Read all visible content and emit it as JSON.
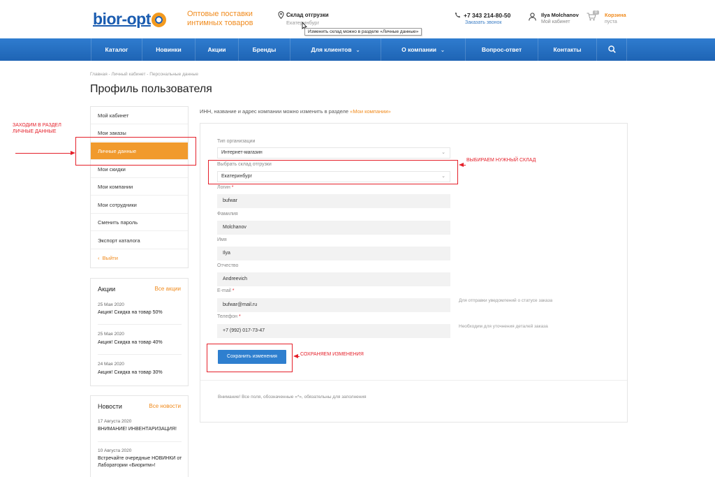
{
  "header": {
    "logo_text": "bior-opt",
    "tagline_line1": "Оптовые поставки",
    "tagline_line2": "интимных товаров",
    "warehouse_title": "Склад отгрузки",
    "warehouse_city": "Екатеринбург",
    "tooltip": "Изменить склад можно в разделе «Личные данные»",
    "phone": "+7 343 214-80-50",
    "callback": "Заказать звонок",
    "user_name": "Ilya Molchanov",
    "user_sub": "Мой кабинет",
    "cart_title": "Корзина",
    "cart_sub": "пуста",
    "cart_count": "0",
    "icons": [
      "map-pin-icon",
      "phone-icon",
      "user-icon",
      "cart-icon",
      "search-icon"
    ]
  },
  "nav": {
    "items": [
      "Каталог",
      "Новинки",
      "Акции",
      "Бренды",
      "Для клиентов",
      "О компании",
      "Вопрос-ответ",
      "Контакты"
    ]
  },
  "breadcrumb": "Главная - Личный кабинет - Персональные данные",
  "page_title": "Профиль пользователя",
  "sidemenu": {
    "items": [
      "Мой кабинет",
      "Мои заказы",
      "Личные данные",
      "Мои скидки",
      "Мои компании",
      "Мои сотрудники",
      "Сменить пароль",
      "Экспорт каталога"
    ],
    "logout": "Выйти"
  },
  "annotations": {
    "section": "Заходим в раздел\nличные данные",
    "warehouse": "Выбираем нужный склад",
    "save": "Сохраняем изменения",
    "color": "#e5202a"
  },
  "promos": {
    "title": "Акции",
    "all": "Все акции",
    "items": [
      {
        "date": "25 Мая 2020",
        "text": "Акция! Скидка на товар 50%"
      },
      {
        "date": "25 Мая 2020",
        "text": "Акция! Скидка на товар 40%"
      },
      {
        "date": "24 Мая 2020",
        "text": "Акция! Скидка на товар 30%"
      }
    ]
  },
  "news": {
    "title": "Новости",
    "all": "Все новости",
    "items": [
      {
        "date": "17 Августа 2020",
        "text": "ВНИМАНИЕ! ИНВЕНТАРИЗАЦИЯ!"
      },
      {
        "date": "10 Августа 2020",
        "text": "Встречайте очередные НОВИНКИ от Лаборатории «Биоритм»!"
      }
    ]
  },
  "intro": {
    "text": "ИНН, название и адрес компании можно изменить в разделе ",
    "link": "«Мои компании»"
  },
  "form": {
    "org_type_label": "Тип организации",
    "org_type_value": "Интернет-магазин",
    "warehouse_label": "Выбрать склад отгрузки",
    "warehouse_value": "Екатеринбург",
    "login_label": "Логин",
    "login_value": "bufwar",
    "lastname_label": "Фамилия",
    "lastname_value": "Molchanov",
    "firstname_label": "Имя",
    "firstname_value": "Ilya",
    "middlename_label": "Отчество",
    "middlename_value": "Andreevich",
    "email_label": "E-mail",
    "email_value": "bufwar@mail.ru",
    "email_hint": "Для отправки уведомлений о статусе заказа",
    "phone_label": "Телефон",
    "phone_value": "+7 (992) 017-73-47",
    "phone_hint": "Необходим для уточнения деталей заказа",
    "save_label": "Сохранить изменения",
    "note": "Внимание! Все поля, обозначенные «*», обязательны для заполнения"
  },
  "colors": {
    "brand_blue": "#1e64b4",
    "accent_orange": "#f19a2d"
  }
}
